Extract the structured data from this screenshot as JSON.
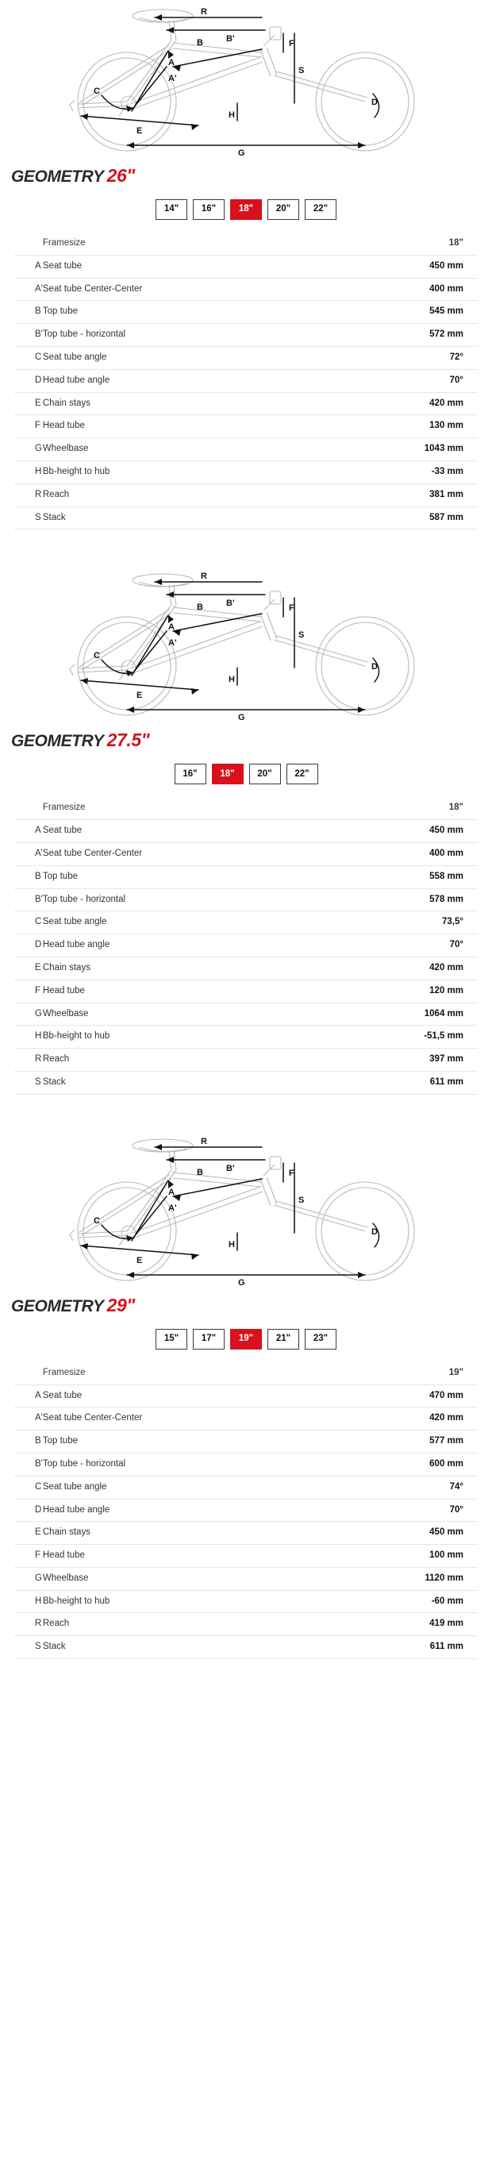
{
  "brand_color": "#d8121c",
  "sections": [
    {
      "heading_word": "GEOMETRY",
      "heading_size": "26\"",
      "diagram_labels": {
        "A": "A",
        "A2": "A'",
        "B": "B",
        "B2": "B'",
        "C": "C",
        "D": "D",
        "E": "E",
        "F": "F",
        "G": "G",
        "H": "H",
        "R": "R",
        "S": "S"
      },
      "sizes": [
        "14\"",
        "16\"",
        "18\"",
        "20\"",
        "22\""
      ],
      "selected_size": "18\"",
      "table": {
        "header": {
          "key": "",
          "label": "Framesize",
          "value": "18\""
        },
        "rows": [
          {
            "key": "A",
            "label": "Seat tube",
            "value": "450 mm"
          },
          {
            "key": "A'",
            "label": "Seat tube Center-Center",
            "value": "400 mm"
          },
          {
            "key": "B",
            "label": "Top tube",
            "value": "545 mm"
          },
          {
            "key": "B'",
            "label": "Top tube - horizontal",
            "value": "572 mm"
          },
          {
            "key": "C",
            "label": "Seat tube angle",
            "value": "72°"
          },
          {
            "key": "D",
            "label": "Head tube angle",
            "value": "70°"
          },
          {
            "key": "E",
            "label": "Chain stays",
            "value": "420 mm"
          },
          {
            "key": "F",
            "label": "Head tube",
            "value": "130 mm"
          },
          {
            "key": "G",
            "label": "Wheelbase",
            "value": "1043 mm"
          },
          {
            "key": "H",
            "label": "Bb-height to hub",
            "value": "-33 mm"
          },
          {
            "key": "R",
            "label": "Reach",
            "value": "381 mm"
          },
          {
            "key": "S",
            "label": "Stack",
            "value": "587 mm"
          }
        ]
      }
    },
    {
      "heading_word": "GEOMETRY",
      "heading_size": "27.5\"",
      "diagram_labels": {
        "A": "A",
        "A2": "A'",
        "B": "B",
        "B2": "B'",
        "C": "C",
        "D": "D",
        "E": "E",
        "F": "F",
        "G": "G",
        "H": "H",
        "R": "R",
        "S": "S"
      },
      "sizes": [
        "16\"",
        "18\"",
        "20\"",
        "22\""
      ],
      "selected_size": "18\"",
      "table": {
        "header": {
          "key": "",
          "label": "Framesize",
          "value": "18\""
        },
        "rows": [
          {
            "key": "A",
            "label": "Seat tube",
            "value": "450 mm"
          },
          {
            "key": "A'",
            "label": "Seat tube Center-Center",
            "value": "400 mm"
          },
          {
            "key": "B",
            "label": "Top tube",
            "value": "558 mm"
          },
          {
            "key": "B'",
            "label": "Top tube - horizontal",
            "value": "578 mm"
          },
          {
            "key": "C",
            "label": "Seat tube angle",
            "value": "73,5°"
          },
          {
            "key": "D",
            "label": "Head tube angle",
            "value": "70°"
          },
          {
            "key": "E",
            "label": "Chain stays",
            "value": "420 mm"
          },
          {
            "key": "F",
            "label": "Head tube",
            "value": "120 mm"
          },
          {
            "key": "G",
            "label": "Wheelbase",
            "value": "1064 mm"
          },
          {
            "key": "H",
            "label": "Bb-height to hub",
            "value": "-51,5 mm"
          },
          {
            "key": "R",
            "label": "Reach",
            "value": "397 mm"
          },
          {
            "key": "S",
            "label": "Stack",
            "value": "611 mm"
          }
        ]
      }
    },
    {
      "heading_word": "GEOMETRY",
      "heading_size": "29\"",
      "diagram_labels": {
        "A": "A",
        "A2": "A'",
        "B": "B",
        "B2": "B'",
        "C": "C",
        "D": "D",
        "E": "E",
        "F": "F",
        "G": "G",
        "H": "H",
        "R": "R",
        "S": "S"
      },
      "sizes": [
        "15\"",
        "17\"",
        "19\"",
        "21\"",
        "23\""
      ],
      "selected_size": "19\"",
      "table": {
        "header": {
          "key": "",
          "label": "Framesize",
          "value": "19\""
        },
        "rows": [
          {
            "key": "A",
            "label": "Seat tube",
            "value": "470 mm"
          },
          {
            "key": "A'",
            "label": "Seat tube Center-Center",
            "value": "420 mm"
          },
          {
            "key": "B",
            "label": "Top tube",
            "value": "577 mm"
          },
          {
            "key": "B'",
            "label": "Top tube - horizontal",
            "value": "600 mm"
          },
          {
            "key": "C",
            "label": "Seat tube angle",
            "value": "74°"
          },
          {
            "key": "D",
            "label": "Head tube angle",
            "value": "70°"
          },
          {
            "key": "E",
            "label": "Chain stays",
            "value": "450 mm"
          },
          {
            "key": "F",
            "label": "Head tube",
            "value": "100 mm"
          },
          {
            "key": "G",
            "label": "Wheelbase",
            "value": "1120 mm"
          },
          {
            "key": "H",
            "label": "Bb-height to hub",
            "value": "-60 mm"
          },
          {
            "key": "R",
            "label": "Reach",
            "value": "419 mm"
          },
          {
            "key": "S",
            "label": "Stack",
            "value": "611 mm"
          }
        ]
      }
    }
  ]
}
